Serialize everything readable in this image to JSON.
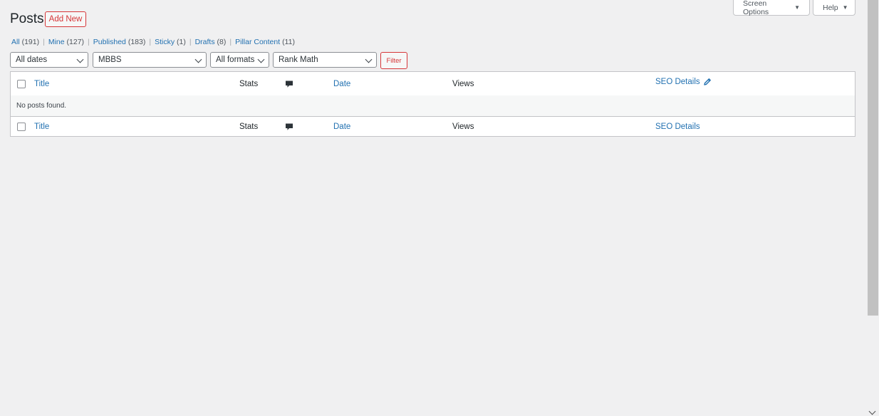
{
  "header": {
    "title": "Posts",
    "add_new_label": "Add New"
  },
  "screen_meta": {
    "screen_options_label": "Screen Options",
    "help_label": "Help",
    "caret_icon": "▼"
  },
  "views": [
    {
      "label": "All",
      "count": "(191)"
    },
    {
      "label": "Mine",
      "count": "(127)"
    },
    {
      "label": "Published",
      "count": "(183)"
    },
    {
      "label": "Sticky",
      "count": "(1)"
    },
    {
      "label": "Drafts",
      "count": "(8)"
    },
    {
      "label": "Pillar Content",
      "count": "(11)"
    }
  ],
  "view_separator": "|",
  "filters": {
    "dates": "All dates",
    "category": "MBBS",
    "formats": "All formats",
    "seo": "Rank Math",
    "filter_label": "Filter"
  },
  "table": {
    "columns": {
      "title": "Title",
      "stats": "Stats",
      "comments_icon": "comment-icon",
      "date": "Date",
      "views": "Views",
      "seo": "SEO Details",
      "seo_edit_icon": "pencil-icon"
    },
    "empty_message": "No posts found."
  },
  "colors": {
    "link": "#2271b1",
    "danger": "#d63638",
    "background": "#f0f0f1"
  }
}
